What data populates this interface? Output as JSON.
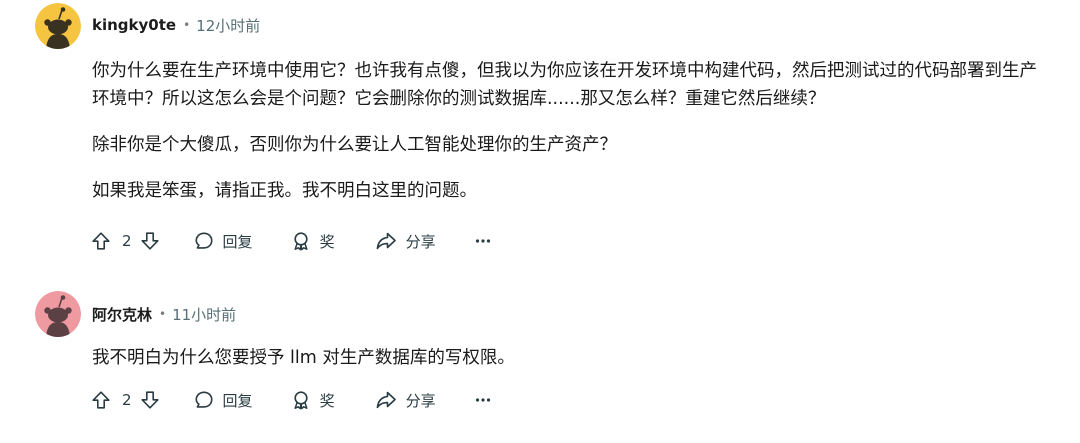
{
  "comments": [
    {
      "author": "kingky0te",
      "separator": "•",
      "time": "12小时前",
      "avatar_color": "#f5c542",
      "paragraphs": [
        "你为什么要在生产环境中使用它？也许我有点傻，但我以为你应该在开发环境中构建代码，然后把测试过的代码部署到生产环境中？所以这怎么会是个问题？它会删除你的测试数据库......那又怎么样？重建它然后继续？",
        "除非你是个大傻瓜，否则你为什么要让人工智能处理你的生产资产？",
        "如果我是笨蛋，请指正我。我不明白这里的问题。"
      ],
      "votes": "2",
      "reply_label": "回复",
      "award_label": "奖",
      "share_label": "分享",
      "more_label": "···"
    },
    {
      "author": "阿尔克林",
      "separator": "•",
      "time": "11小时前",
      "avatar_color": "#ef9aa1",
      "paragraphs": [
        "我不明白为什么您要授予 llm 对生产数据库的写权限。"
      ],
      "votes": "2",
      "reply_label": "回复",
      "award_label": "奖",
      "share_label": "分享",
      "more_label": "···"
    }
  ],
  "icons": {
    "upvote": "upvote-arrow-icon",
    "downvote": "downvote-arrow-icon",
    "reply": "speech-bubble-icon",
    "award": "award-ribbon-icon",
    "share": "share-arrow-icon",
    "more": "ellipsis-icon"
  }
}
